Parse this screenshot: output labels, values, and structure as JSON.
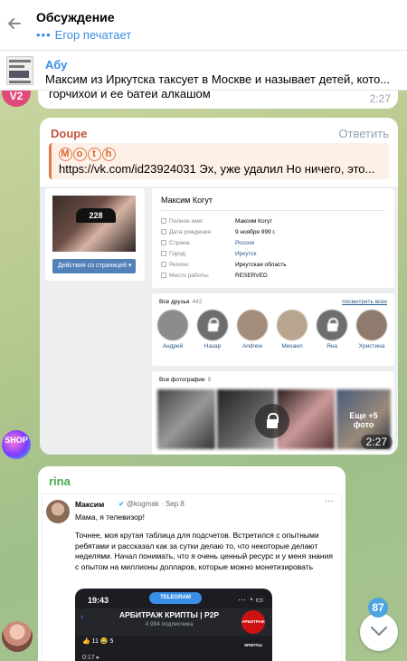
{
  "header": {
    "title": "Обсуждение",
    "typing_dots": "•••",
    "typing_text": "Егор печатает"
  },
  "pinned": {
    "author": "Абу",
    "text": "Максим из Иркутска таксует в Москве и называет детей, кото..."
  },
  "messages": {
    "m1": {
      "text": "горчихой и ее батей алкашом",
      "time": "2:27",
      "avatar_label": "V2"
    },
    "m2": {
      "author": "Doupe",
      "reply_action": "Ответить",
      "quote_author_letters": [
        "M",
        "o",
        "t",
        "h"
      ],
      "quote_text": "https://vk.com/id23924031 Эх, уже удалил Но ничего, это...",
      "time": "2:27",
      "vk": {
        "cap_text": "228",
        "action_button": "Действия со страницей ▾",
        "name": "Максим Когут",
        "rows": [
          {
            "label": "Полное имя:",
            "value": "Максим Когут",
            "link": false
          },
          {
            "label": "Дата рождения:",
            "value": "9 ноября 999 г.",
            "link": false
          },
          {
            "label": "Страна:",
            "value": "Россия",
            "link": true
          },
          {
            "label": "Город:",
            "value": "Иркутск",
            "link": true
          },
          {
            "label": "Регион:",
            "value": "Иркутская область",
            "link": false
          },
          {
            "label": "Место работы:",
            "value": "RESERVED",
            "link": false
          }
        ],
        "friends_header": "Все друзья",
        "friends_count": "442",
        "friends_all": "посмотреть всех",
        "friends": [
          {
            "name": "Андрей",
            "locked": false
          },
          {
            "name": "Назар",
            "locked": true
          },
          {
            "name": "Andrew",
            "locked": false
          },
          {
            "name": "Михаил",
            "locked": false
          },
          {
            "name": "Яна",
            "locked": true
          },
          {
            "name": "Христина",
            "locked": false
          }
        ],
        "photos_header": "Все фотографии",
        "photos_count": "9",
        "photos_more": "Еще +5 фото"
      }
    },
    "m3": {
      "author": "rina",
      "avatar_label": "SHOP",
      "tweet": {
        "name": "Максим",
        "handle_date": "@kogmak · Sep 8",
        "first_line": "Мама, я телевизор!",
        "body": "Точнее, моя крутая таблица для подсчетов. Встретился с опытными ребятами и рассказал как за сутки делаю то, что некоторые делают неделями. Начал понимать, что я очень ценный ресурс и у меня знания с опытом на миллионы долларов, которые можно монетизировать",
        "phone": {
          "time": "19:43",
          "pill": "TELEGRAM",
          "status": "··· ◔ ▭",
          "channel": "АРБИТРАЖ КРИПТЫ | P2P",
          "subscribers": "4 994 подписчика",
          "logo_text": "АРБИТРАЖ КРИПТЫ",
          "reactions": "👍 11   😂 5",
          "views": "0:17 ▸"
        }
      }
    }
  },
  "unread_badge": "87"
}
